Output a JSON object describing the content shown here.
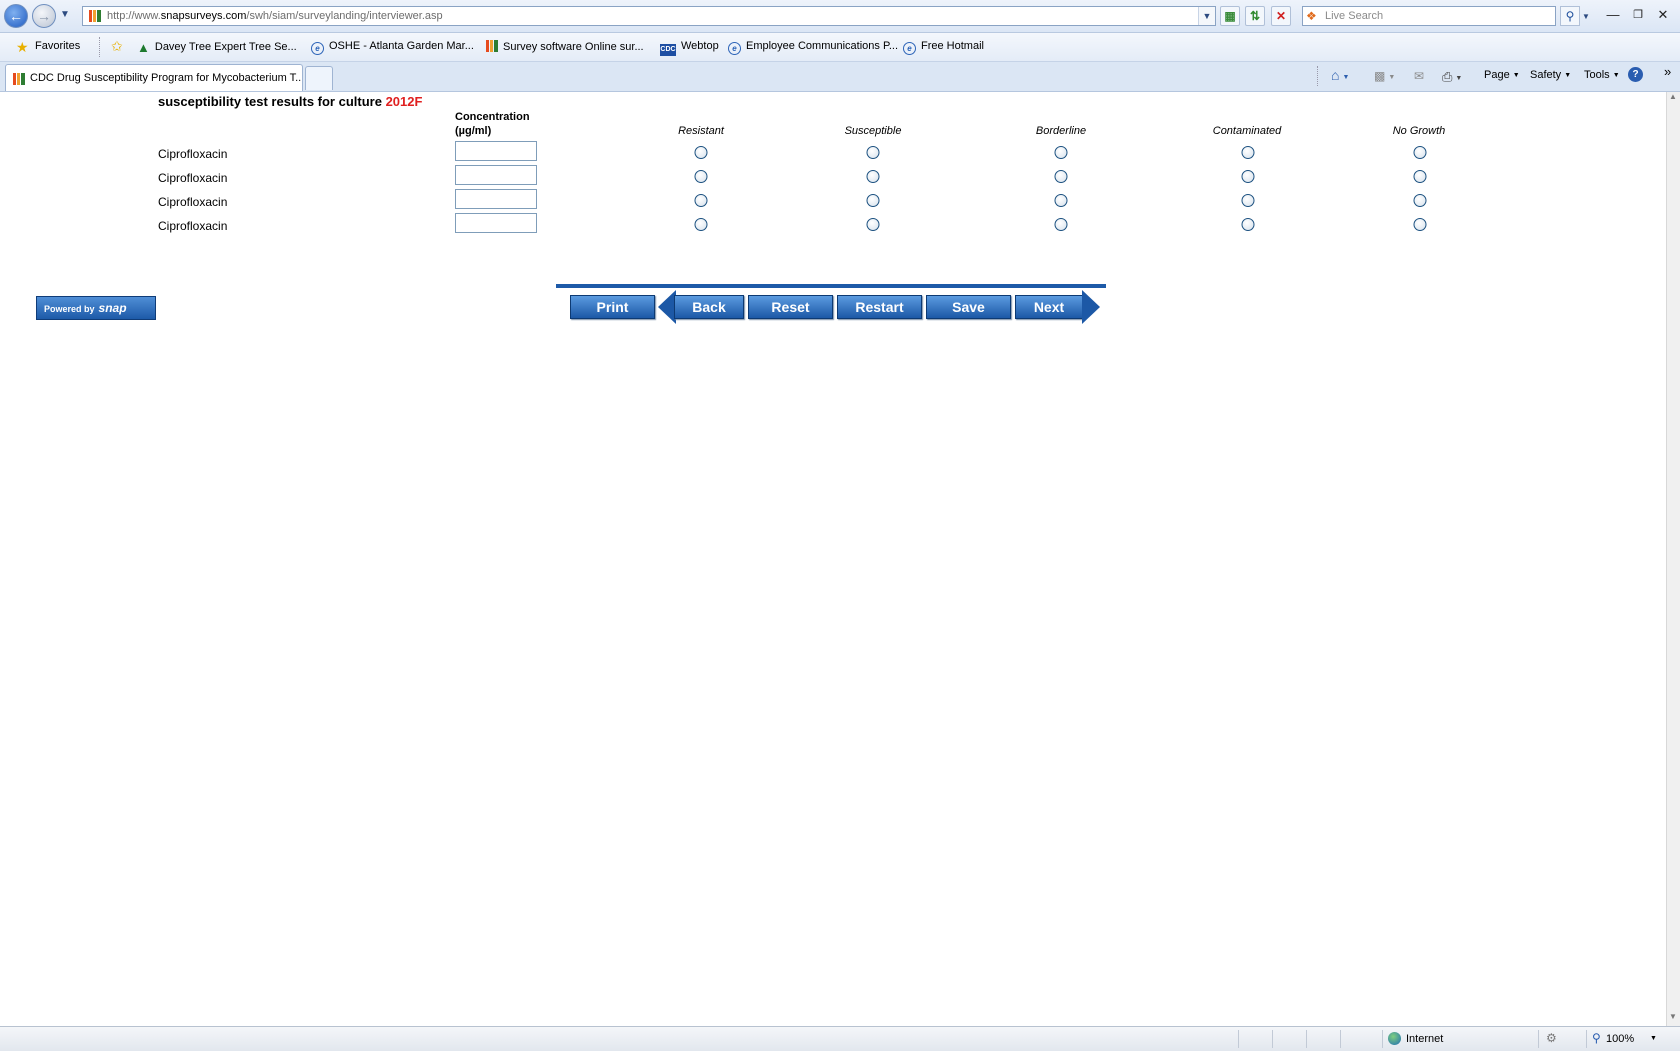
{
  "browser": {
    "url_host_prefix": "http://www.",
    "url_host": "snapsurveys.com",
    "url_path": "/swh/siam/surveylanding/interviewer.asp",
    "search_placeholder": "Live Search",
    "favorites_label": "Favorites",
    "favorites": [
      {
        "label": "Davey Tree  Expert Tree Se...",
        "icon": "tree-icon"
      },
      {
        "label": "OSHE - Atlanta Garden Mar...",
        "icon": "ie-page-icon"
      },
      {
        "label": "Survey software  Online sur...",
        "icon": "bars-icon"
      },
      {
        "label": "Webtop",
        "icon": "cdc-icon"
      },
      {
        "label": "Employee Communications P...",
        "icon": "ie-page-icon"
      },
      {
        "label": "Free Hotmail",
        "icon": "ie-page-icon"
      }
    ],
    "active_tab_title": "CDC Drug Susceptibility Program for Mycobacterium T...",
    "command_bar": {
      "page": "Page",
      "safety": "Safety",
      "tools": "Tools"
    },
    "status": {
      "zone": "Internet",
      "zoom": "100%"
    }
  },
  "survey": {
    "title_prefix": "susceptibility test results for culture",
    "culture_id": "2012F",
    "concentration_header_line1": "Concentration",
    "concentration_header_line2": "(µg/ml)",
    "result_columns": [
      "Resistant",
      "Susceptible",
      "Borderline",
      "Contaminated",
      "No Growth"
    ],
    "rows": [
      {
        "drug": "Ciprofloxacin",
        "concentration": ""
      },
      {
        "drug": "Ciprofloxacin",
        "concentration": ""
      },
      {
        "drug": "Ciprofloxacin",
        "concentration": ""
      },
      {
        "drug": "Ciprofloxacin",
        "concentration": ""
      }
    ],
    "powered_by": "Powered by",
    "powered_by_brand": "snap",
    "buttons": {
      "print": "Print",
      "back": "Back",
      "reset": "Reset",
      "restart": "Restart",
      "save": "Save",
      "next": "Next"
    }
  },
  "colors": {
    "culture_id": "#e02020",
    "button_blue": "#1c58a6",
    "radio_border": "#1c5180"
  }
}
